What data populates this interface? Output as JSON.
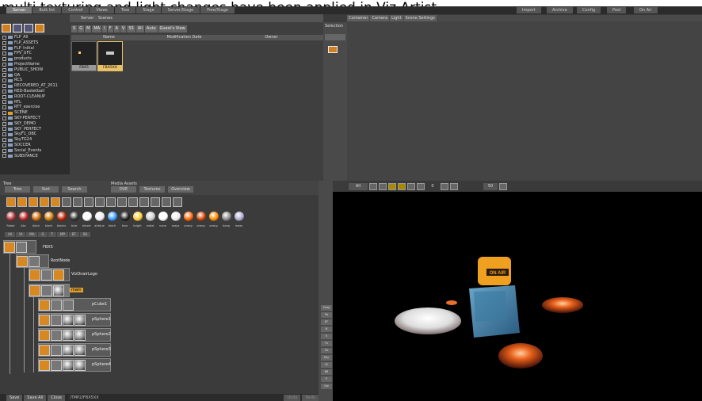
{
  "caption": "multi texturing and light changes have been applied in Viz Artist.",
  "menu": {
    "tabs": [
      "Server",
      "Bulk list",
      "Control",
      "Views",
      "Tree",
      "Stage",
      "Server/Stage",
      "Free/Stage"
    ],
    "right": [
      "Import",
      "Archive",
      "Config",
      "Post",
      "On Air"
    ]
  },
  "server": {
    "label": "Server",
    "mode": "Scenes"
  },
  "filter": {
    "buttons": [
      "S",
      "G",
      "M",
      "MA",
      "I",
      "F",
      "A",
      "V",
      "SS",
      "All",
      "Auto",
      "Guest's View"
    ]
  },
  "columns": {
    "name": "Name",
    "modified": "Modification Date",
    "owner": "Owner"
  },
  "tree_items": [
    "FLP_All",
    "FLP_ASSETS",
    "FLP_Initial",
    "FPV_UFC",
    "products",
    "ProjectName",
    "PUBLIC_SHOW",
    "QA",
    "RCS",
    "RECOVERED_AT_2011",
    "RED-Basketball",
    "ROOT-CLEANUP",
    "RTL",
    "RTT_exercise",
    "SCENE",
    "SKY-PERFECT",
    "SKY_DEMO",
    "SKY_PERFECT",
    "SkyF1_OBC",
    "SkyTG24",
    "SOCCER",
    "Social_Events",
    "SUBSTANCE"
  ],
  "thumbs": [
    {
      "label": "FBX5"
    },
    {
      "label": "FBX5XX"
    }
  ],
  "right_tabs": [
    "Container",
    "Camera",
    "Light",
    "Scene Settings"
  ],
  "selection_label": "Selection",
  "tree_section": {
    "title": "Tree",
    "tabs": [
      "Tree",
      "Sort",
      "Search"
    ]
  },
  "media_section": {
    "title": "Media Assets",
    "tabs": [
      "DVE",
      "Textures",
      "Overview"
    ]
  },
  "materials": [
    "Robot",
    "Abc",
    "black",
    "blank",
    "blanks",
    "blue",
    "blazer",
    "artblue",
    "black",
    "blue",
    "bright",
    "metal",
    "none",
    "maya",
    "orang",
    "orang",
    "orang",
    "bang",
    "meas"
  ],
  "scene_tabs": [
    "All",
    "Vt",
    "MA",
    "G",
    "T",
    "MP",
    "EF",
    "SH"
  ],
  "scene_nodes": {
    "root": "FBX5",
    "rootnode": "RootNode",
    "logo": "VizOnairLogo",
    "main": "main",
    "cube": "pCube1",
    "spheres": [
      "pSphere1",
      "pSphere2",
      "pSphere3",
      "pSphere4"
    ]
  },
  "bottom": {
    "save": "Save",
    "save_all": "Save All",
    "close": "Close",
    "path": "/TMP2/FBX5XX",
    "undo": "Undo",
    "redo": "Redo"
  },
  "side_buttons": [
    "Snap",
    "Pb",
    "KF",
    "N",
    "E",
    "Tx",
    "SA",
    "Key",
    "W",
    "BB",
    "P",
    "Gw"
  ],
  "view": {
    "mode": "All",
    "field": "0",
    "zoom": "50",
    "logo_text": "ON AIR"
  }
}
